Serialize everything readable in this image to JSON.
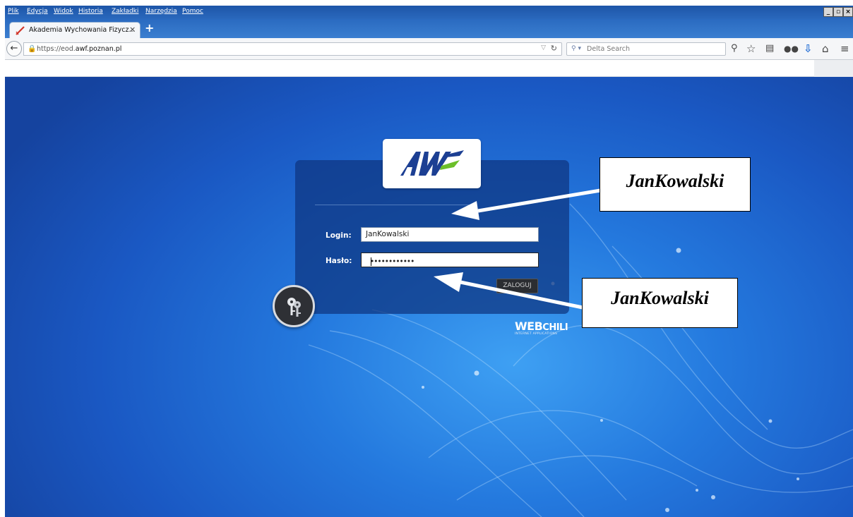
{
  "menu": [
    "Plik",
    "Edycja",
    "Widok",
    "Historia",
    "Zakładki",
    "Narzędzia",
    "Pomoc"
  ],
  "window_controls": [
    "_",
    "▫",
    "×"
  ],
  "tab": {
    "title": "Akademia Wychowania Fizycz...",
    "close": "×",
    "new_tab": "+"
  },
  "nav": {
    "url_prefix": "https://eod.",
    "url_domain": "awf.poznan.pl",
    "search_engine_icon": "search-engine-icon",
    "search_placeholder": "Delta Search"
  },
  "logo": {
    "text": "AWF",
    "accent_color": "#6cbf2a",
    "brand_color": "#1c3f93"
  },
  "login": {
    "login_label": "Login:",
    "login_value": "JanKowalski",
    "password_label": "Hasło:",
    "password_value": "••••••••••••",
    "submit_label": "ZALOGUJ"
  },
  "footer_brand": {
    "main": "WEB",
    "chili": "CHILI",
    "sub": "INTERNET APPLICATIONS"
  },
  "annotations": [
    {
      "text": "JanKowalski",
      "points_to": "login field"
    },
    {
      "text": "JanKowalski",
      "points_to": "password field"
    }
  ],
  "colors": {
    "page_bg": "#2479de",
    "panel_bg": "#0e3480",
    "button_bg": "#2b2d31"
  }
}
